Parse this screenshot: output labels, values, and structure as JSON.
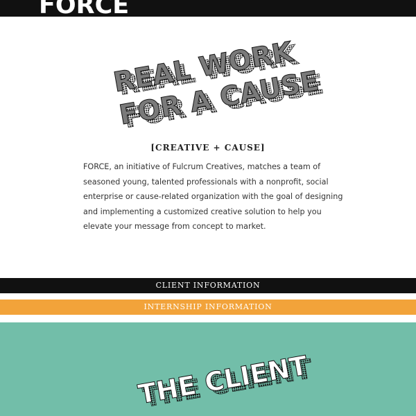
{
  "header": {
    "logo": "FORCE"
  },
  "hero": {
    "line1": "REAL WORK",
    "line2": "FOR A CAUSE"
  },
  "intro": {
    "tagline": "[CREATIVE + CAUSE]",
    "body": "FORCE, an initiative of Fulcrum Creatives, matches a team of seasoned young, talented professionals with a nonprofit, social enterprise or cause-related organization with the goal of designing and implementing a customized creative solution to help you elevate your message from concept to market."
  },
  "nav": {
    "client_label": "CLIENT INFORMATION",
    "internship_label": "INTERNSHIP INFORMATION"
  },
  "client_section": {
    "heading": "THE CLIENT"
  },
  "colors": {
    "black": "#111111",
    "orange": "#f2a33a",
    "teal": "#72bea9",
    "hero_gray": "#7a7a7a"
  }
}
